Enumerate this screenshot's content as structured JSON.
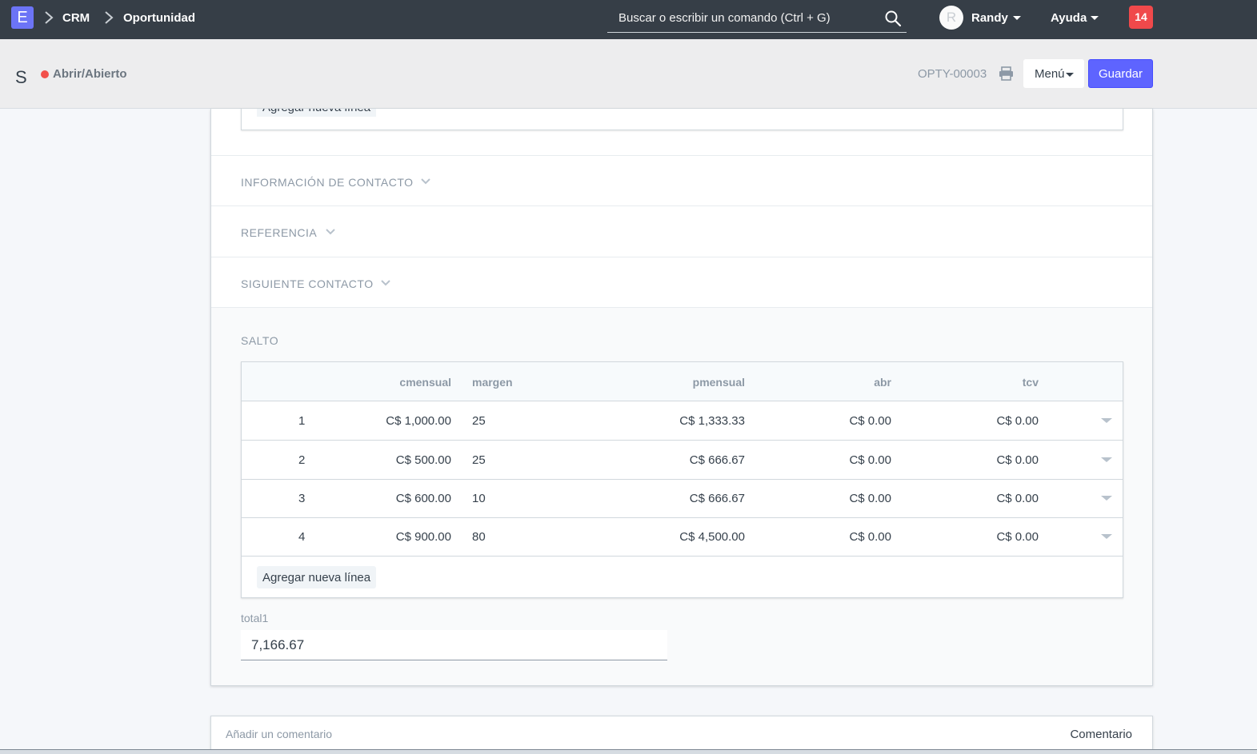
{
  "navbar": {
    "logo": "E",
    "breadcrumbs": [
      "CRM",
      "Oportunidad"
    ],
    "search_placeholder": "Buscar o escribir un comando (Ctrl + G)",
    "avatar_initial": "R",
    "user_name": "Randy",
    "help_label": "Ayuda",
    "notification_count": "14"
  },
  "page_head": {
    "title": "S",
    "status": "Abrir/Abierto",
    "doc_name": "OPTY-00003",
    "menu_label": "Menú",
    "save_label": "Guardar"
  },
  "form": {
    "prev_add_row_label": "Agregar nueva línea",
    "sections": [
      "INFORMACIÓN DE CONTACTO",
      "REFERENCIA",
      "SIGUIENTE CONTACTO"
    ],
    "salto": {
      "title": "SALTO",
      "columns": [
        "cmensual",
        "margen",
        "pmensual",
        "abr",
        "tcv"
      ],
      "rows": [
        {
          "idx": "1",
          "cmensual": "C$ 1,000.00",
          "margen": "25",
          "pmensual": "C$ 1,333.33",
          "abr": "C$ 0.00",
          "tcv": "C$ 0.00"
        },
        {
          "idx": "2",
          "cmensual": "C$ 500.00",
          "margen": "25",
          "pmensual": "C$ 666.67",
          "abr": "C$ 0.00",
          "tcv": "C$ 0.00"
        },
        {
          "idx": "3",
          "cmensual": "C$ 600.00",
          "margen": "10",
          "pmensual": "C$ 666.67",
          "abr": "C$ 0.00",
          "tcv": "C$ 0.00"
        },
        {
          "idx": "4",
          "cmensual": "C$ 900.00",
          "margen": "80",
          "pmensual": "C$ 4,500.00",
          "abr": "C$ 0.00",
          "tcv": "C$ 0.00"
        }
      ],
      "add_row_label": "Agregar nueva línea"
    },
    "total_label": "total1",
    "total_value": "7,166.67"
  },
  "comments": {
    "placeholder": "Añadir un comentario",
    "button_label": "Comentario"
  },
  "colors": {
    "navbar_bg": "#363e47",
    "logo_bg": "#6c74f6",
    "primary": "#5e64ff",
    "notification": "#f0494b",
    "status_open": "#f2504b"
  }
}
